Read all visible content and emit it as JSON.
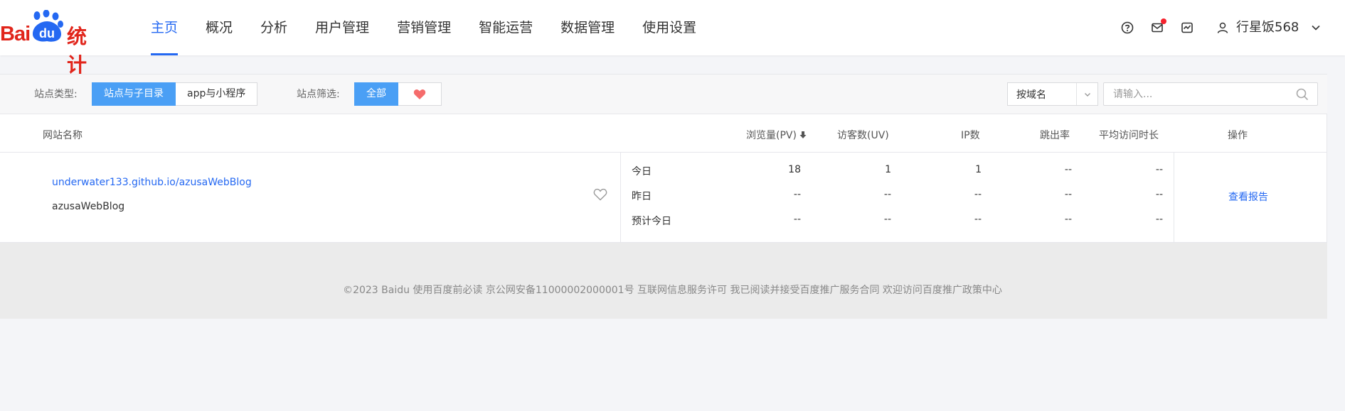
{
  "brand": {
    "logo_bai": "Bai",
    "logo_du": "du",
    "logo_suffix": "统计",
    "accent": "#2468f2",
    "logo_color": "#e1251b"
  },
  "nav": [
    {
      "label": "主页",
      "active": true
    },
    {
      "label": "概况"
    },
    {
      "label": "分析"
    },
    {
      "label": "用户管理"
    },
    {
      "label": "营销管理"
    },
    {
      "label": "智能运营"
    },
    {
      "label": "数据管理"
    },
    {
      "label": "使用设置"
    }
  ],
  "header_icons": [
    "help-icon",
    "message-icon",
    "chart-icon"
  ],
  "user": {
    "name": "行星饭568"
  },
  "filters": {
    "site_type_label": "站点类型:",
    "site_type_options": [
      "站点与子目录",
      "app与小程序"
    ],
    "site_type_selected": "站点与子目录",
    "site_filter_label": "站点筛选:",
    "site_filter_all": "全部",
    "search_scope": "按域名",
    "search_placeholder": "请输入..."
  },
  "table": {
    "headers": {
      "site": "网站名称",
      "pv": "浏览量(PV)",
      "uv": "访客数(UV)",
      "ip": "IP数",
      "bounce": "跳出率",
      "avg_time": "平均访问时长",
      "action": "操作"
    },
    "rows": [
      {
        "url": "underwater133.github.io/azusaWebBlog",
        "name": "azusaWebBlog",
        "periods": [
          {
            "label": "今日",
            "pv": "18",
            "uv": "1",
            "ip": "1",
            "bounce": "--",
            "avg_time": "--"
          },
          {
            "label": "昨日",
            "pv": "--",
            "uv": "--",
            "ip": "--",
            "bounce": "--",
            "avg_time": "--"
          },
          {
            "label": "预计今日",
            "pv": "--",
            "uv": "--",
            "ip": "--",
            "bounce": "--",
            "avg_time": "--"
          }
        ],
        "action": "查看报告"
      }
    ]
  },
  "footer": {
    "text": "©2023 Baidu 使用百度前必读 京公网安备11000002000001号 互联网信息服务许可 我已阅读并接受百度推广服务合同 欢迎访问百度推广政策中心"
  }
}
